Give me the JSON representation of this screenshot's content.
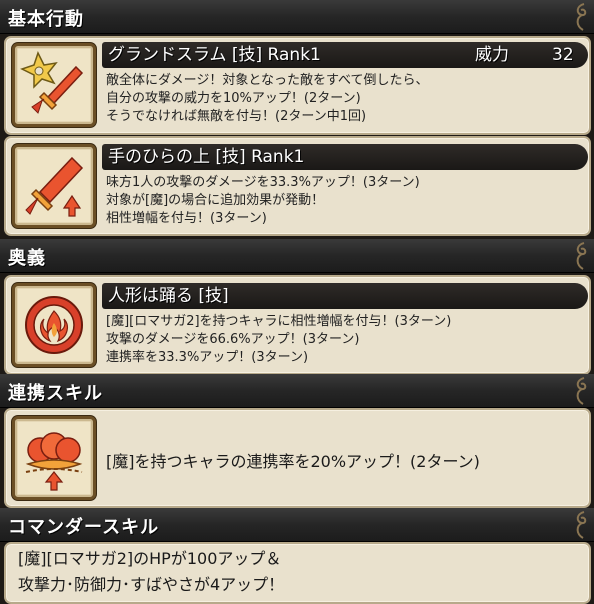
{
  "sections": {
    "basic": {
      "title": "基本行動",
      "skills": [
        {
          "name": "グランドスラム [技]  Rank1",
          "power_label": "威力",
          "power_value": "32",
          "lines": [
            "敵全体にダメージ！対象となった敵をすべて倒したら、",
            "自分の攻撃の威力を10%アップ！(2ターン)",
            "そうでなければ無敵を付与！(2ターン中1回)"
          ],
          "icon": "shuriken-sword-icon"
        },
        {
          "name": "手のひらの上 [技]  Rank1",
          "lines": [
            "味方1人の攻撃のダメージを33.3%アップ！(3ターン)",
            "対象が[魔]の場合に追加効果が発動！",
            "相性増幅を付与！(3ターン)"
          ],
          "icon": "sword-up-icon"
        }
      ]
    },
    "ougi": {
      "title": "奥義",
      "skill": {
        "name": "人形は踊る [技]",
        "lines": [
          "[魔][ロマサガ2]を持つキャラに相性増幅を付与！(3ターン)",
          "攻撃のダメージを66.6%アップ！(3ターン)",
          "連携率を33.3%アップ！(3ターン)"
        ],
        "icon": "flame-burst-icon"
      }
    },
    "combo": {
      "title": "連携スキル",
      "text": "[魔]を持つキャラの連携率を20%アップ！(2ターン)",
      "icon": "combo-up-icon"
    },
    "commander": {
      "title": "コマンダースキル",
      "lines": [
        "[魔][ロマサガ2]のHPが100アップ＆",
        "攻撃力･防御力･すばやさが4アップ！"
      ]
    }
  },
  "colors": {
    "panel_bg": "#e9e1cd",
    "header_bg": "#262626",
    "title_bar": "#1f1c1a",
    "icon_red": "#d8402a",
    "icon_orange": "#f2a23a"
  }
}
